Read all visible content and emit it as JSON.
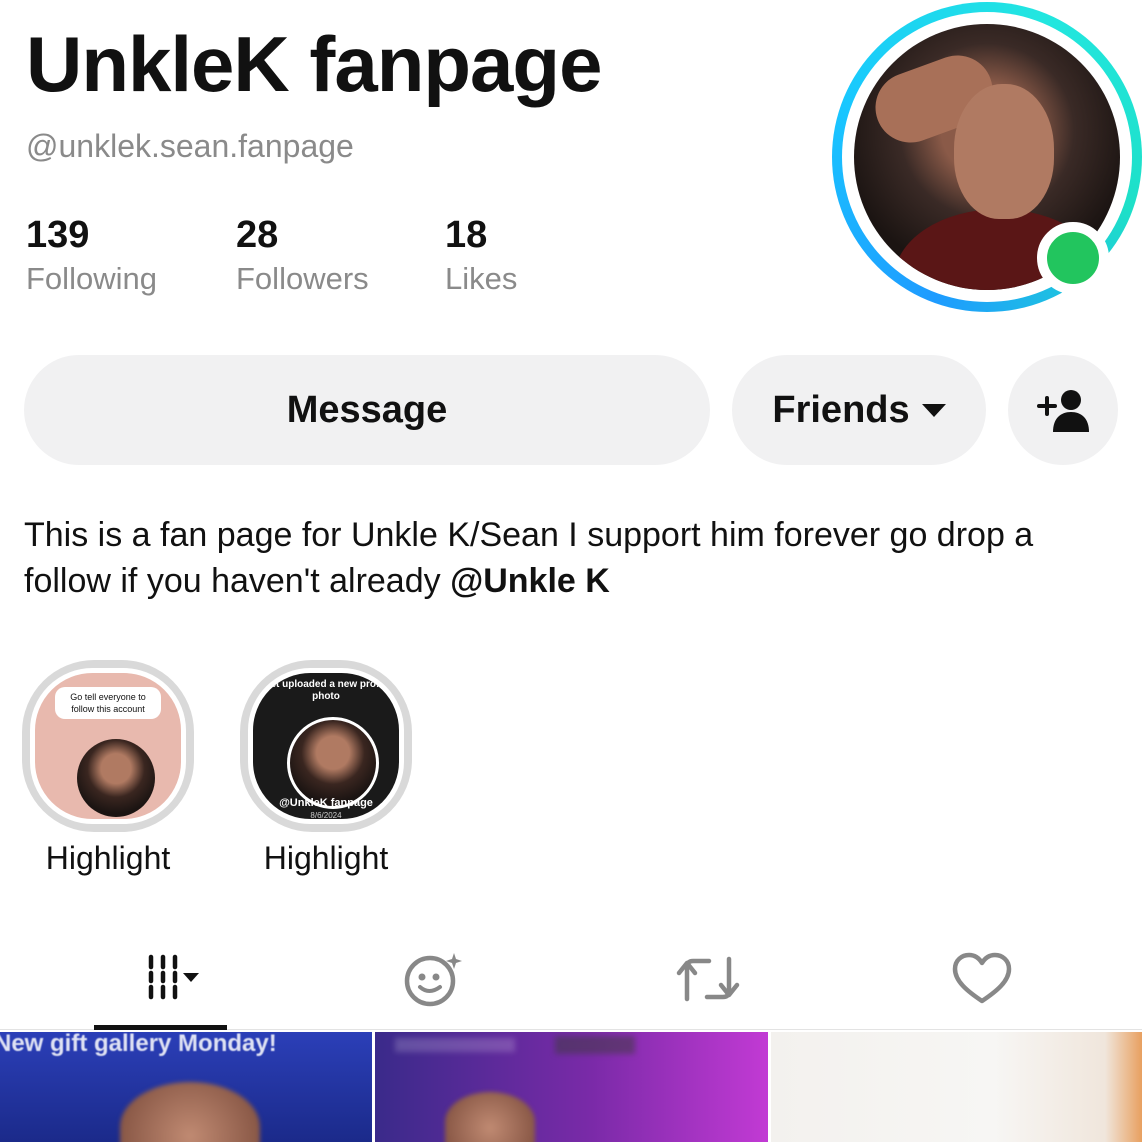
{
  "profile": {
    "display_name": "UnkleK fanpage",
    "username": "@unklek.sean.fanpage",
    "online_color": "#22c55e"
  },
  "stats": {
    "following": {
      "value": "139",
      "label": "Following"
    },
    "followers": {
      "value": "28",
      "label": "Followers"
    },
    "likes": {
      "value": "18",
      "label": "Likes"
    }
  },
  "actions": {
    "message_label": "Message",
    "friends_label": "Friends",
    "add_friend_icon": "add-person-icon"
  },
  "bio": {
    "text": "This is a fan page for Unkle K/Sean I support him forever go drop a follow if you haven't already ",
    "mention": "@Unkle K"
  },
  "highlights": [
    {
      "label": "Highlight",
      "preview_text": "Go tell everyone to follow this account"
    },
    {
      "label": "Highlight",
      "preview_top": "just uploaded a new profile photo",
      "preview_bottom": "@UnkleK fanpage",
      "preview_date": "8/6/2024"
    }
  ],
  "tabs": [
    {
      "name": "videos",
      "icon": "grid-icon",
      "active": true
    },
    {
      "name": "ai",
      "icon": "ai-face-icon"
    },
    {
      "name": "reposts",
      "icon": "repost-icon"
    },
    {
      "name": "liked",
      "icon": "heart-icon"
    }
  ],
  "thumbnails": [
    {
      "caption": "New gift gallery Monday!"
    },
    {
      "caption": ""
    },
    {
      "caption": ""
    }
  ]
}
